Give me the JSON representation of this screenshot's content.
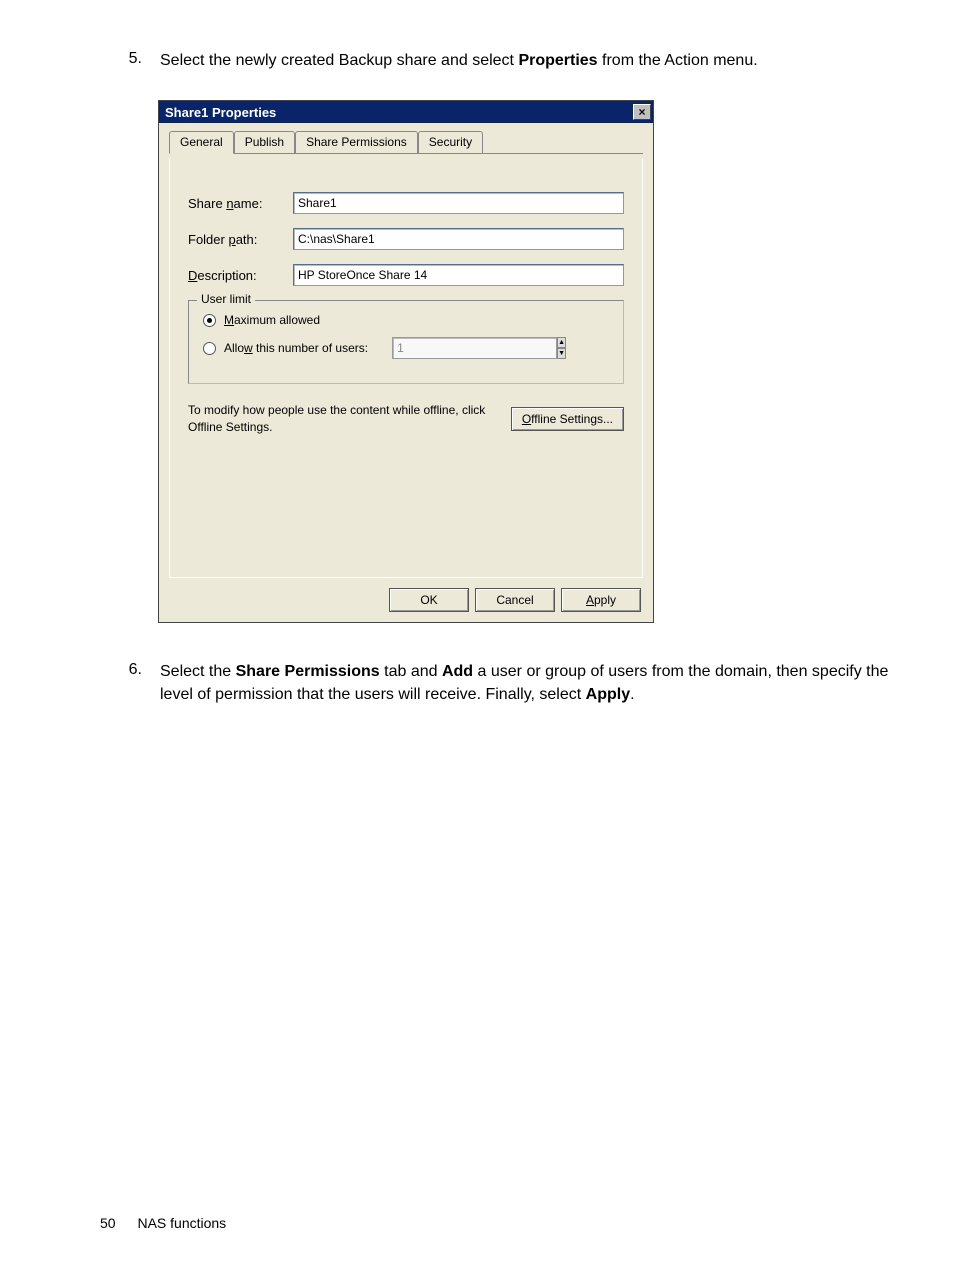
{
  "steps": {
    "step5": {
      "num": "5.",
      "before": "Select the newly created Backup share and select ",
      "bold": "Properties",
      "after": " from the Action menu."
    },
    "step6": {
      "num": "6.",
      "b1": "Share Permissions",
      "t1": "Select the ",
      "t2": " tab and ",
      "b2": "Add",
      "t3": " a user or group of users from the domain, then specify the level of permission that the users will receive. Finally, select ",
      "b3": "Apply",
      "t4": "."
    }
  },
  "dialog": {
    "title": "Share1 Properties",
    "close": "×",
    "tabs": {
      "general": "General",
      "publish": "Publish",
      "share_permissions": "Share Permissions",
      "security": "Security"
    },
    "labels": {
      "share_name_pre": "Share ",
      "share_name_ul": "n",
      "share_name_post": "ame:",
      "folder_path_pre": "Folder ",
      "folder_path_ul": "p",
      "folder_path_post": "ath:",
      "description_ul": "D",
      "description_post": "escription:"
    },
    "values": {
      "share_name": "Share1",
      "folder_path": "C:\\nas\\Share1",
      "description": "HP StoreOnce Share 14"
    },
    "user_limit": {
      "group_title": "User limit",
      "max_ul": "M",
      "max_post": "aximum allowed",
      "allow_pre": "Allo",
      "allow_ul": "w",
      "allow_post": " this number of users:",
      "spinner_value": "1"
    },
    "offline": {
      "text": "To modify how people use the content while offline, click Offline Settings.",
      "btn_ul": "O",
      "btn_post": "ffline Settings..."
    },
    "buttons": {
      "ok": "OK",
      "cancel": "Cancel",
      "apply_ul": "A",
      "apply_post": "pply"
    }
  },
  "footer": {
    "page": "50",
    "section": "NAS functions"
  }
}
